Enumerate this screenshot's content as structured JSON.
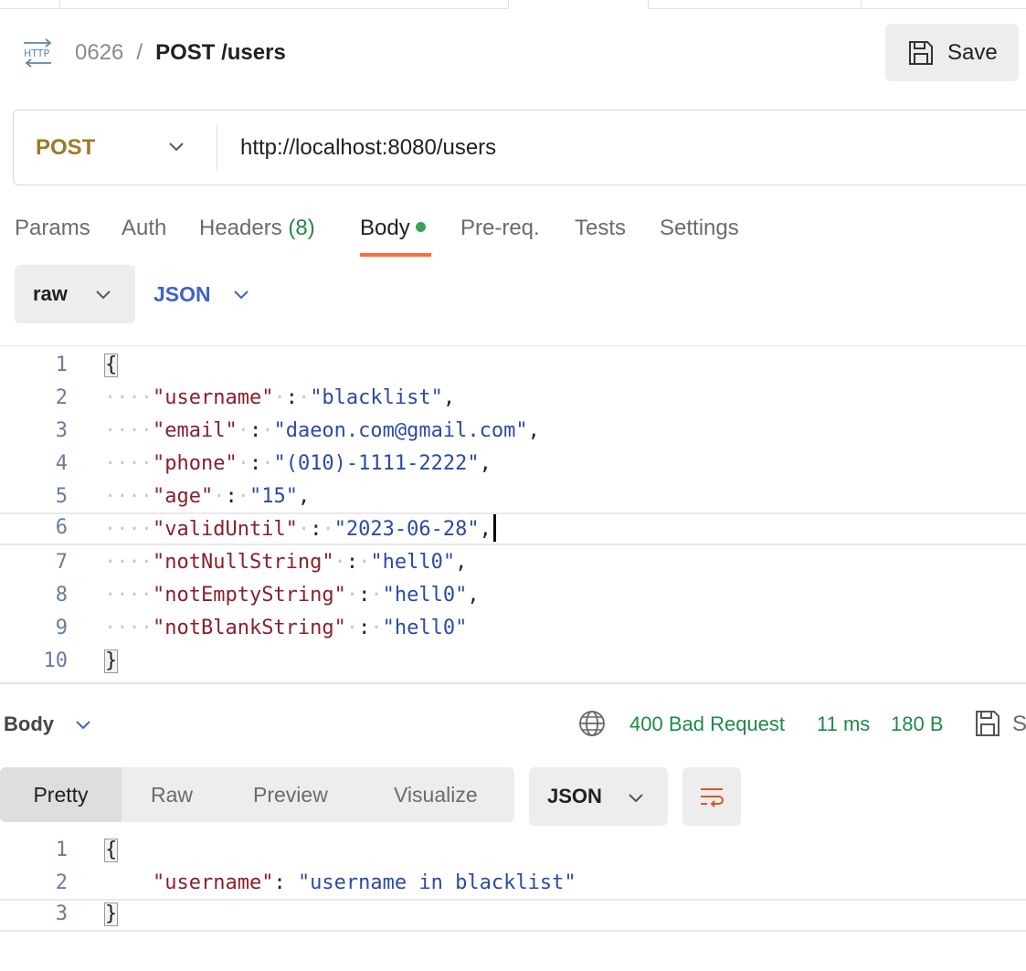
{
  "header": {
    "collection_id": "0626",
    "separator": "/",
    "request_name": "POST /users",
    "save_label": "Save"
  },
  "request": {
    "method": "POST",
    "url": "http://localhost:8080/users"
  },
  "tabs": [
    {
      "label": "Params"
    },
    {
      "label": "Auth"
    },
    {
      "label": "Headers",
      "count": "(8)"
    },
    {
      "label": "Body",
      "active": true,
      "dot_color": "#3aa55a"
    },
    {
      "label": "Pre-req."
    },
    {
      "label": "Tests"
    },
    {
      "label": "Settings"
    }
  ],
  "body_mode": {
    "mode": "raw",
    "format": "JSON"
  },
  "request_body": {
    "line_numbers": [
      "1",
      "2",
      "3",
      "4",
      "5",
      "6",
      "7",
      "8",
      "9",
      "10"
    ],
    "open_brace": "{",
    "close_brace": "}",
    "entries": [
      {
        "key": "\"username\"",
        "value": "\"blacklist\"",
        "comma": ","
      },
      {
        "key": "\"email\"",
        "value": "\"daeon.com@gmail.com\"",
        "comma": ","
      },
      {
        "key": "\"phone\"",
        "value": "\"(010)-1111-2222\"",
        "comma": ","
      },
      {
        "key": "\"age\"",
        "value": "\"15\"",
        "comma": ","
      },
      {
        "key": "\"validUntil\"",
        "value": "\"2023-06-28\"",
        "comma": ","
      },
      {
        "key": "\"notNullString\"",
        "value": "\"hell0\"",
        "comma": ","
      },
      {
        "key": "\"notEmptyString\"",
        "value": "\"hell0\"",
        "comma": ","
      },
      {
        "key": "\"notBlankString\"",
        "value": "\"hell0\"",
        "comma": ""
      }
    ]
  },
  "response": {
    "section_label": "Body",
    "status": "400 Bad Request",
    "time": "11 ms",
    "size": "180 B",
    "save_truncated": "S",
    "view_tabs": [
      "Pretty",
      "Raw",
      "Preview",
      "Visualize"
    ],
    "active_view": "Pretty",
    "format": "JSON",
    "line_numbers": [
      "1",
      "2",
      "3"
    ],
    "open_brace": "{",
    "close_brace": "}",
    "key": "\"username\"",
    "colon": ": ",
    "value": "\"username in blacklist\""
  },
  "colors": {
    "method": "#a0782a",
    "accent": "#ff6c37",
    "success": "#1e8a4a",
    "json_link": "#3e63c6"
  },
  "icons": [
    "http-icon",
    "save-icon",
    "chevron-down-icon",
    "globe-icon",
    "wrap-lines-icon"
  ]
}
